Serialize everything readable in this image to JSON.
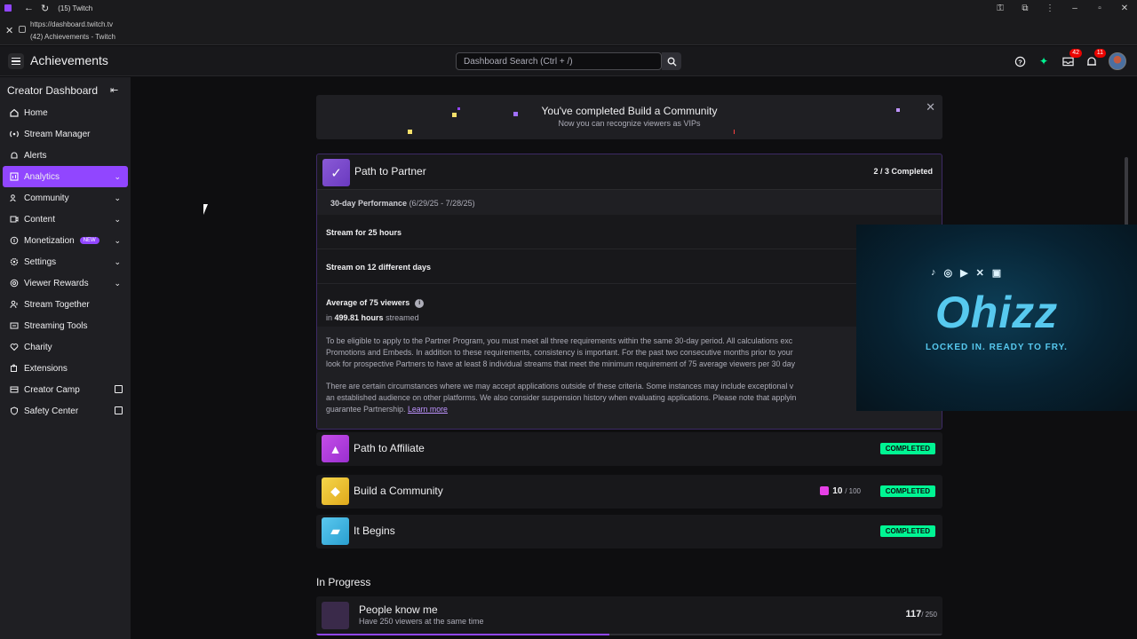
{
  "browser": {
    "tab_title": "(15) Twitch",
    "popup_url": "https://dashboard.twitch.tv",
    "popup_title": "(42) Achievements - Twitch"
  },
  "topnav": {
    "page_title": "Achievements",
    "search_placeholder": "Dashboard Search (Ctrl + /)",
    "inbox_badge": "42",
    "notifications_badge": "11"
  },
  "sidebar": {
    "header": "Creator Dashboard",
    "items": [
      {
        "label": "Home"
      },
      {
        "label": "Stream Manager"
      },
      {
        "label": "Alerts"
      },
      {
        "label": "Analytics"
      },
      {
        "label": "Community"
      },
      {
        "label": "Content"
      },
      {
        "label": "Monetization",
        "tag": "NEW"
      },
      {
        "label": "Settings"
      },
      {
        "label": "Viewer Rewards"
      },
      {
        "label": "Stream Together"
      },
      {
        "label": "Streaming Tools"
      },
      {
        "label": "Charity"
      },
      {
        "label": "Extensions"
      },
      {
        "label": "Creator Camp"
      },
      {
        "label": "Safety Center"
      }
    ]
  },
  "banner": {
    "title": "You've completed Build a Community",
    "subtitle": "Now you can recognize viewers as VIPs"
  },
  "partner": {
    "title": "Path to Partner",
    "count": "2 / 3 Completed",
    "performance_label": "30-day Performance",
    "performance_range": "(6/29/25 - 7/28/25)",
    "req1": "Stream for 25 hours",
    "req2": "Stream on 12 different days",
    "req3": "Average of 75 viewers",
    "req3_sub_prefix": "in",
    "req3_hours": "499.81 hours",
    "req3_sub_suffix": "streamed",
    "para1_line1": "To be eligible to apply to the Partner Program, you must meet all three requirements within the same 30-day period. All calculations exc",
    "para1_line2": "Promotions and Embeds. In addition to these requirements, consistency is important. For the past two consecutive months prior to your",
    "para1_line3": "look for prospective Partners to have at least 8 individual streams that meet the minimum requirement of 75 average viewers per 30 day",
    "para2_line1": "There are certain circumstances where we may accept applications outside of these criteria. Some instances may include exceptional v",
    "para2_line2": "an established audience on other platforms. We also consider suspension history when evaluating applications. Please note that applyin",
    "para2_line3": "guarantee Partnership.",
    "learn_more": "Learn more"
  },
  "overlay": {
    "name": "Ohizz",
    "tagline": "LOCKED IN. READY TO FRY."
  },
  "achievements": {
    "completed_label": "COMPLETED",
    "affiliate": "Path to Affiliate",
    "community": "Build a Community",
    "community_count": "10",
    "community_total": "/ 100",
    "begins": "It Begins"
  },
  "in_progress": {
    "heading": "In Progress",
    "title": "People know me",
    "subtitle": "Have 250 viewers at the same time",
    "count": "117",
    "total": "/ 250",
    "progress": 0.468
  },
  "colors": {
    "accent": "#9146ff",
    "completed": "#00f593",
    "overlay_text": "#57c9ef"
  }
}
